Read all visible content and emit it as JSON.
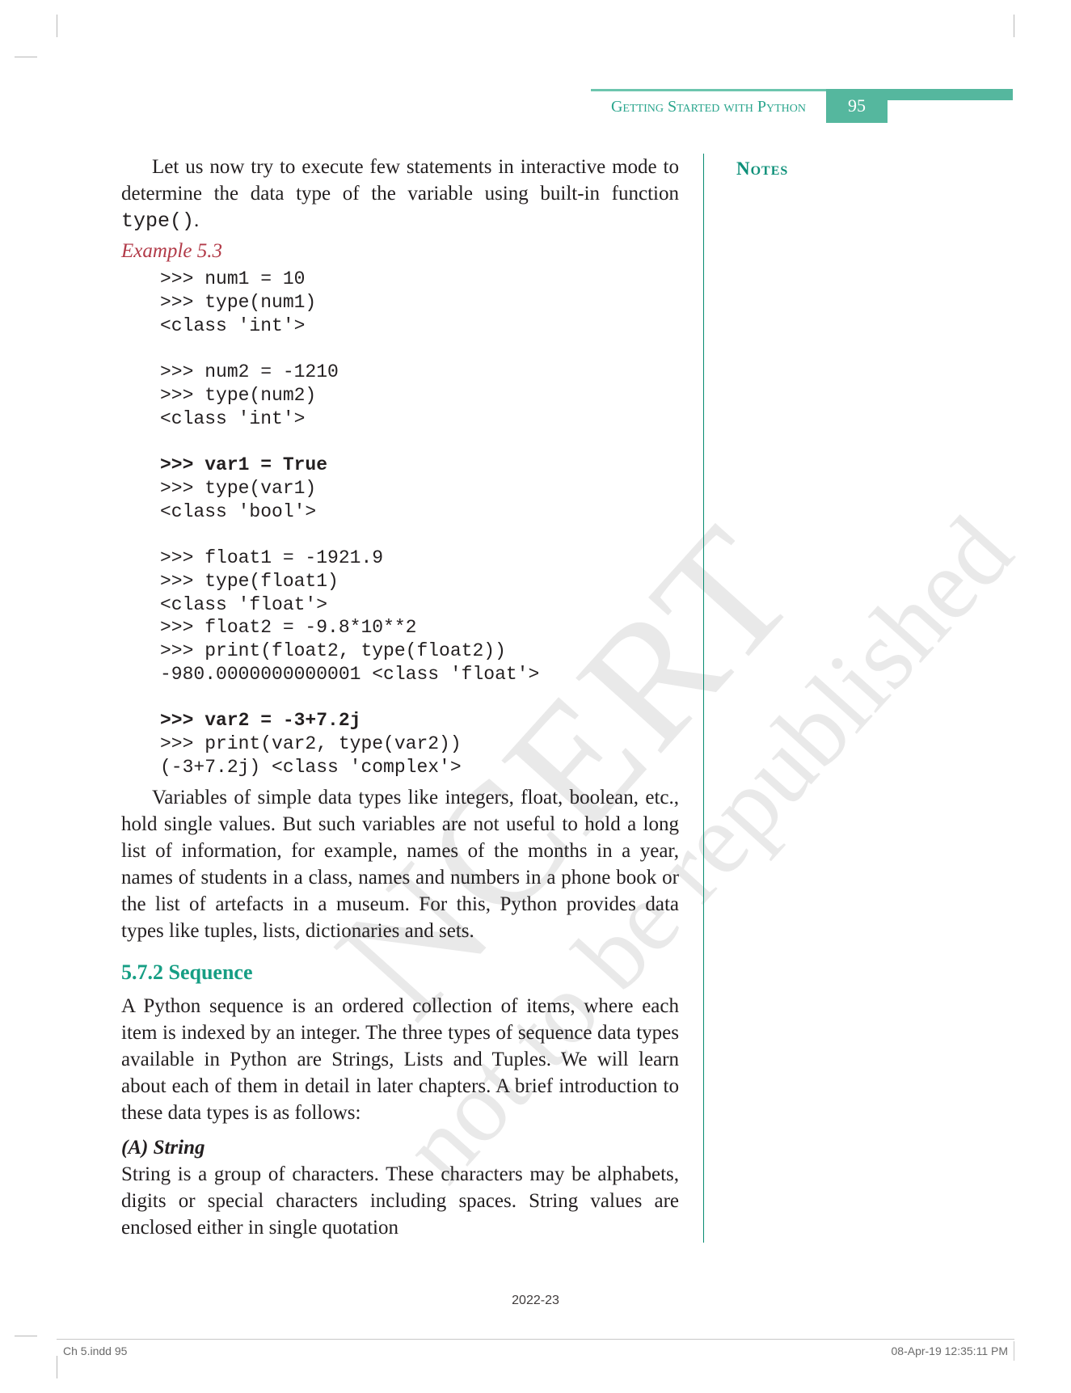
{
  "header": {
    "chapter_title": "Getting Started with Python",
    "page_number": "95"
  },
  "sidebar": {
    "notes_label": "Notes"
  },
  "body": {
    "intro_para": "Let us now try to execute few statements in interactive mode to determine the data type of the variable using built-in function ",
    "intro_code": "type()",
    "intro_tail": ".",
    "example_label": "Example 5.3",
    "code": {
      "l01": ">>> num1 = 10",
      "l02": ">>> type(num1)",
      "l03": "<class 'int'>",
      "l04": ">>> num2 = -1210",
      "l05": ">>> type(num2)",
      "l06": "<class 'int'>",
      "l07": ">>> var1 = True",
      "l08": ">>> type(var1)",
      "l09": "<class 'bool'>",
      "l10": ">>> float1 = -1921.9",
      "l11": ">>> type(float1)",
      "l12": "<class 'float'>",
      "l13": ">>> float2 = -9.8*10**2",
      "l14": ">>> print(float2, type(float2))",
      "l15": "-980.0000000000001 <class 'float'>",
      "l16": ">>> var2 = -3+7.2j",
      "l17": ">>> print(var2, type(var2))",
      "l18": "(-3+7.2j) <class 'complex'>"
    },
    "para2": "Variables of simple data types like integers, float, boolean, etc., hold single values. But such variables are not useful to hold a long list of information, for example, names of the months in a year, names of students in a class, names and numbers in a phone book or the list of artefacts in a museum. For this, Python provides data types like tuples, lists, dictionaries and sets.",
    "section_heading": "5.7.2 Sequence",
    "para3": "A Python sequence is an ordered collection of items, where each item is indexed by an integer. The three types of sequence data types available in Python are Strings, Lists and Tuples. We will learn about each of them in detail in later chapters. A brief introduction to these data types is as follows:",
    "sub_a": "(A)  String",
    "para4": "String is a group of characters. These characters may be alphabets, digits or special characters including spaces. String values are enclosed either in single quotation"
  },
  "watermarks": {
    "wm1": "NCERT",
    "wm2": "not to be republished"
  },
  "footer": {
    "year": "2022-23",
    "left": "Ch 5.indd   95",
    "right": "08-Apr-19   12:35:11 PM"
  }
}
